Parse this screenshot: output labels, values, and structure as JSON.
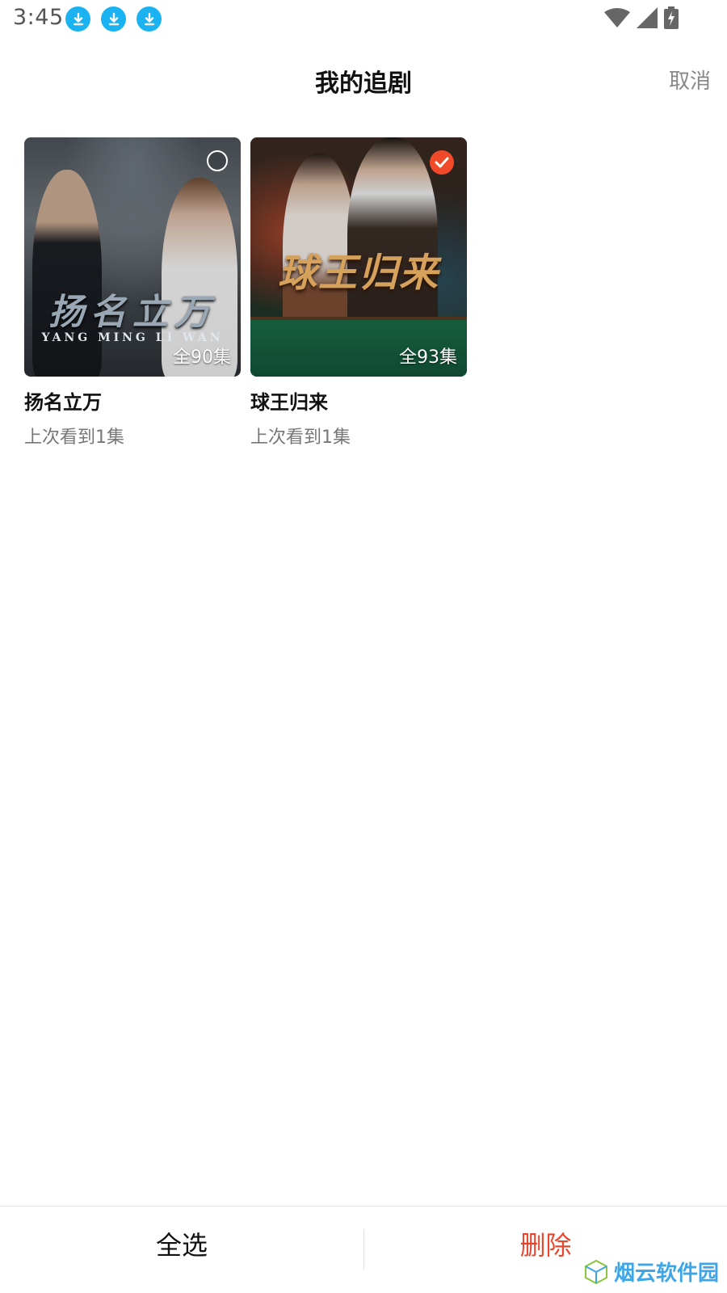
{
  "status_bar": {
    "time": "3:45",
    "notification_icons": [
      "download-icon",
      "download-icon",
      "download-icon"
    ],
    "icons": [
      "wifi-icon",
      "signal-icon",
      "battery-charging-icon"
    ]
  },
  "header": {
    "title": "我的追剧",
    "cancel_label": "取消"
  },
  "dramas": [
    {
      "title": "扬名立万",
      "episodes": "全90集",
      "progress": "上次看到1集",
      "poster_title": "扬名立万",
      "poster_subtitle": "YANG MING LI WAN",
      "selected": false
    },
    {
      "title": "球王归来",
      "episodes": "全93集",
      "progress": "上次看到1集",
      "poster_title": "球王归来",
      "selected": true
    }
  ],
  "bottom_bar": {
    "select_all_label": "全选",
    "delete_label": "删除"
  },
  "watermark": {
    "text": "烟云软件园",
    "icon": "cube-logo-icon"
  },
  "colors": {
    "accent_red": "#e8462c",
    "check_red": "#f04a2a",
    "download_blue": "#1ab2f0",
    "watermark_blue": "#3ea6e8"
  }
}
